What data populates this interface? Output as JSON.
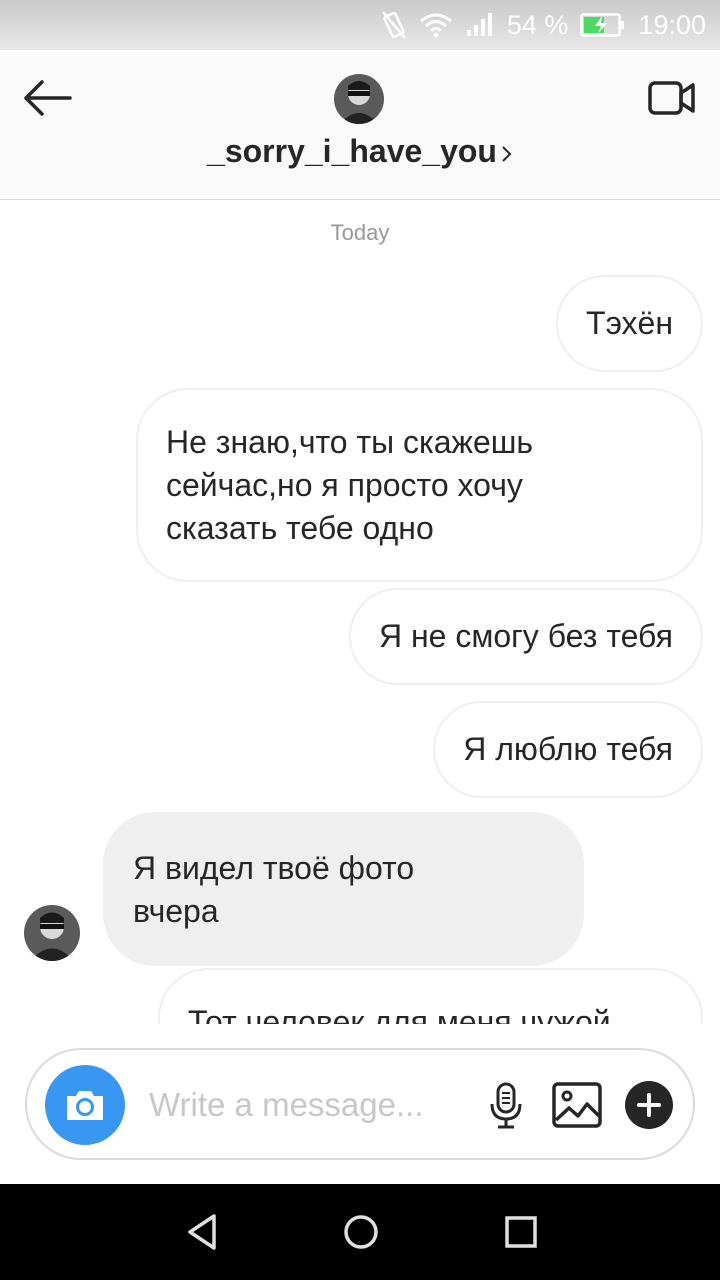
{
  "status_bar": {
    "battery_percent": "54 %",
    "time": "19:00",
    "icons": [
      "vibrate-icon",
      "wifi-icon",
      "signal-icon",
      "battery-charging-icon"
    ]
  },
  "header": {
    "username": "_sorry_i_have_you",
    "icons": [
      "back-arrow-icon",
      "avatar",
      "chevron-right-icon",
      "video-call-icon"
    ]
  },
  "chat": {
    "date_separator": "Today",
    "messages": [
      {
        "sender": "me",
        "lines": [
          "Тэхён"
        ]
      },
      {
        "sender": "me",
        "lines": [
          "Не знаю,что ты скажешь",
          "сейчас,но я просто хочу",
          "сказать тебе одно"
        ]
      },
      {
        "sender": "me",
        "lines": [
          "Я не смогу без тебя"
        ]
      },
      {
        "sender": "me",
        "lines": [
          "Я люблю тебя"
        ]
      },
      {
        "sender": "them",
        "lines": [
          "Я видел твоё фото",
          "вчера"
        ]
      },
      {
        "sender": "me",
        "lines": [
          "Тот человек для меня чужой"
        ]
      }
    ]
  },
  "composer": {
    "placeholder": "Write a message...",
    "icons": [
      "camera-icon",
      "microphone-icon",
      "gallery-icon",
      "plus-icon"
    ],
    "accent_color": "#3897f0"
  },
  "nav_bar": {
    "icons": [
      "nav-back-icon",
      "nav-home-icon",
      "nav-recents-icon"
    ]
  }
}
